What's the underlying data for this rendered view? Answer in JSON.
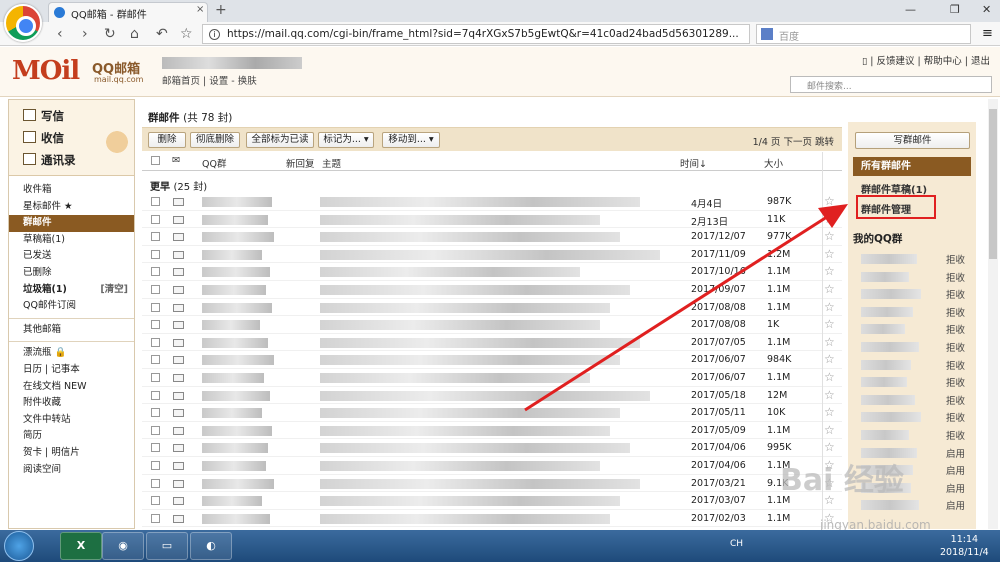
{
  "browser": {
    "tab_title": "QQ邮箱 - 群邮件",
    "tab_close": "×",
    "new_tab": "+",
    "window_controls": [
      "—",
      "❐",
      "✕"
    ],
    "url": "https://mail.qq.com/cgi-bin/frame_html?sid=7q4rXGxS7b5gEwtQ&r=41c0ad24bad5d56301289...",
    "search_engine": "百度",
    "menu_icon": "≡"
  },
  "header": {
    "logo_text": "MOil",
    "logo_sub": "QQ邮箱",
    "logo_url": "mail.qq.com",
    "sub_links": [
      "邮箱首页",
      "设置",
      "换肤"
    ],
    "top_links": [
      "反馈建议",
      "帮助中心",
      "退出"
    ],
    "search_placeholder": "邮件搜索..."
  },
  "sidebar": {
    "actions": [
      "写信",
      "收信",
      "通讯录"
    ],
    "folders": [
      {
        "label": "收件箱"
      },
      {
        "label": "星标邮件 ★"
      },
      {
        "label": "群邮件",
        "active": true
      },
      {
        "label": "草稿箱(1)"
      },
      {
        "label": "已发送"
      },
      {
        "label": "已删除"
      },
      {
        "label": "垃圾箱(1)",
        "bold": true,
        "right": "[清空]"
      },
      {
        "label": "QQ邮件订阅"
      }
    ],
    "other_folders": [
      {
        "label": "其他邮箱"
      }
    ],
    "apps": [
      {
        "label": "漂流瓶 🔒"
      },
      {
        "label": "日历 | 记事本"
      },
      {
        "label": "在线文档 NEW"
      },
      {
        "label": "附件收藏"
      },
      {
        "label": "文件中转站"
      },
      {
        "label": "简历"
      },
      {
        "label": "贺卡 | 明信片"
      },
      {
        "label": "阅读空间"
      }
    ]
  },
  "main": {
    "title": "群邮件",
    "count": "(共 78 封)",
    "buttons": [
      "删除",
      "彻底删除",
      "全部标为已读",
      "标记为... ▾",
      "移动到... ▾"
    ],
    "pager": {
      "page": "1/4 页",
      "next": "下一页",
      "jump": "跳转"
    },
    "columns": [
      "QQ群",
      "新回复",
      "主题",
      "时间↓",
      "大小"
    ],
    "group_label": "更早",
    "group_count": "(25 封)",
    "rows": [
      {
        "date": "4月4日",
        "size": "987K"
      },
      {
        "date": "2月13日",
        "size": "11K"
      },
      {
        "date": "2017/12/07",
        "size": "977K"
      },
      {
        "date": "2017/11/09",
        "size": "1.2M"
      },
      {
        "date": "2017/10/16",
        "size": "1.1M"
      },
      {
        "date": "2017/09/07",
        "size": "1.1M"
      },
      {
        "date": "2017/08/08",
        "size": "1.1M"
      },
      {
        "date": "2017/08/08",
        "size": "1K"
      },
      {
        "date": "2017/07/05",
        "size": "1.1M"
      },
      {
        "date": "2017/06/07",
        "size": "984K"
      },
      {
        "date": "2017/06/07",
        "size": "1.1M"
      },
      {
        "date": "2017/05/18",
        "size": "12M"
      },
      {
        "date": "2017/05/11",
        "size": "10K"
      },
      {
        "date": "2017/05/09",
        "size": "1.1M"
      },
      {
        "date": "2017/04/06",
        "size": "995K"
      },
      {
        "date": "2017/04/06",
        "size": "1.1M"
      },
      {
        "date": "2017/03/21",
        "size": "9.1K"
      },
      {
        "date": "2017/03/07",
        "size": "1.1M"
      },
      {
        "date": "2017/02/03",
        "size": "1.1M"
      }
    ]
  },
  "right_panel": {
    "write_group_mail": "写群邮件",
    "all_group_mail": "所有群邮件",
    "drafts": "群邮件草稿(1)",
    "manage": "群邮件管理",
    "my_groups": "我的QQ群",
    "groups": [
      {
        "action": "拒收"
      },
      {
        "action": "拒收"
      },
      {
        "action": "拒收"
      },
      {
        "action": "拒收"
      },
      {
        "action": "拒收"
      },
      {
        "action": "拒收"
      },
      {
        "action": "拒收"
      },
      {
        "action": "拒收"
      },
      {
        "action": "拒收"
      },
      {
        "action": "拒收"
      },
      {
        "action": "拒收"
      },
      {
        "action": "启用"
      },
      {
        "action": "启用"
      },
      {
        "action": "启用"
      },
      {
        "action": "启用"
      }
    ]
  },
  "taskbar": {
    "items": [
      "X",
      "",
      "",
      ""
    ],
    "tray_text": "CH",
    "time": "11:14",
    "date": "2018/11/4"
  },
  "watermark": {
    "text": "Bai 经验",
    "sub": "jingyan.baidu.com"
  },
  "colors": {
    "accent": "#8a5a22",
    "annotation": "#e02020"
  }
}
